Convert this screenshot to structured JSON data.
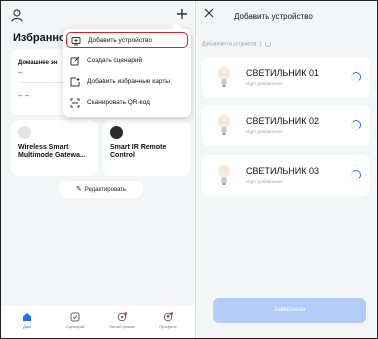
{
  "home": {
    "favorites_title": "Избранное",
    "card_home": {
      "label": "Домашнее эн",
      "value1": "--",
      "value2": "-- --"
    },
    "devices": [
      {
        "name": "Wireless Smart Multimode Gatewa...",
        "dot_color": "#e3e3e3"
      },
      {
        "name": "Smart IR Remote Control",
        "dot_color": "#2b2b2b"
      }
    ],
    "edit_label": "Редактировать",
    "tabs": [
      {
        "label": "Дом",
        "icon": "home-icon",
        "active": true
      },
      {
        "label": "Сценарий",
        "icon": "scenario-icon",
        "active": false
      },
      {
        "label": "Умный режим",
        "icon": "smart-icon",
        "active": false
      },
      {
        "label": "Профиль",
        "icon": "profile-icon",
        "active": false
      }
    ]
  },
  "menu": {
    "items": [
      {
        "label": "Добавить устройство",
        "icon": "add-device-icon",
        "highlighted": true
      },
      {
        "label": "Создать сценарий",
        "icon": "create-scene-icon",
        "highlighted": false
      },
      {
        "label": "Добавить избранные карты",
        "icon": "add-favorite-card-icon",
        "highlighted": false
      },
      {
        "label": "Сканировать QR-код",
        "icon": "scan-qr-icon",
        "highlighted": false
      }
    ]
  },
  "add_device": {
    "title": "Добавить устройство",
    "subtitle": "Добавляется устройств: 1",
    "devices": [
      {
        "name": "СВЕТИЛЬНИК 01",
        "status": "Идет добавление"
      },
      {
        "name": "СВЕТИЛЬНИК 02",
        "status": "Идет добавление"
      },
      {
        "name": "СВЕТИЛЬНИК 03",
        "status": "Идет добавление"
      }
    ],
    "done_label": "Завершено"
  },
  "colors": {
    "accent": "#1e6fff",
    "highlight_border": "#d5222c",
    "background": "#f4f5f7",
    "done_button": "#b3ccf7"
  }
}
